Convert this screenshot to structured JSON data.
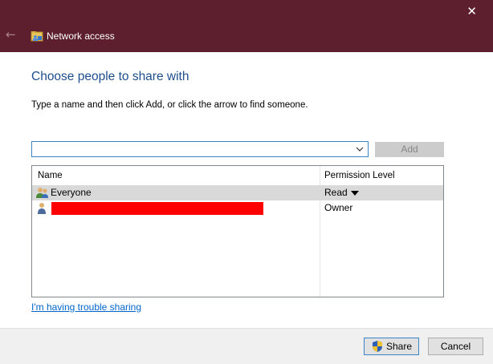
{
  "window": {
    "title": "Network access",
    "close_glyph": "✕",
    "back_glyph": "←"
  },
  "heading": "Choose people to share with",
  "instruction": "Type a name and then click Add, or click the arrow to find someone.",
  "name_input": {
    "value": "",
    "placeholder": ""
  },
  "add_button": "Add",
  "table": {
    "columns": [
      "Name",
      "Permission Level"
    ],
    "rows": [
      {
        "name": "Everyone",
        "permission": "Read",
        "icon": "group-users-icon",
        "selected": true,
        "has_dropdown": true
      },
      {
        "name": "",
        "permission": "Owner",
        "icon": "user-icon",
        "selected": false,
        "redacted": true
      }
    ]
  },
  "trouble_link": "I'm having trouble sharing",
  "footer": {
    "share_button": "Share",
    "cancel_button": "Cancel"
  },
  "colors": {
    "titlebar": "#5d1f2d",
    "heading": "#1e4e8e",
    "link": "#0066cc",
    "selection": "#d9d9d9",
    "redaction": "#ff0000"
  }
}
